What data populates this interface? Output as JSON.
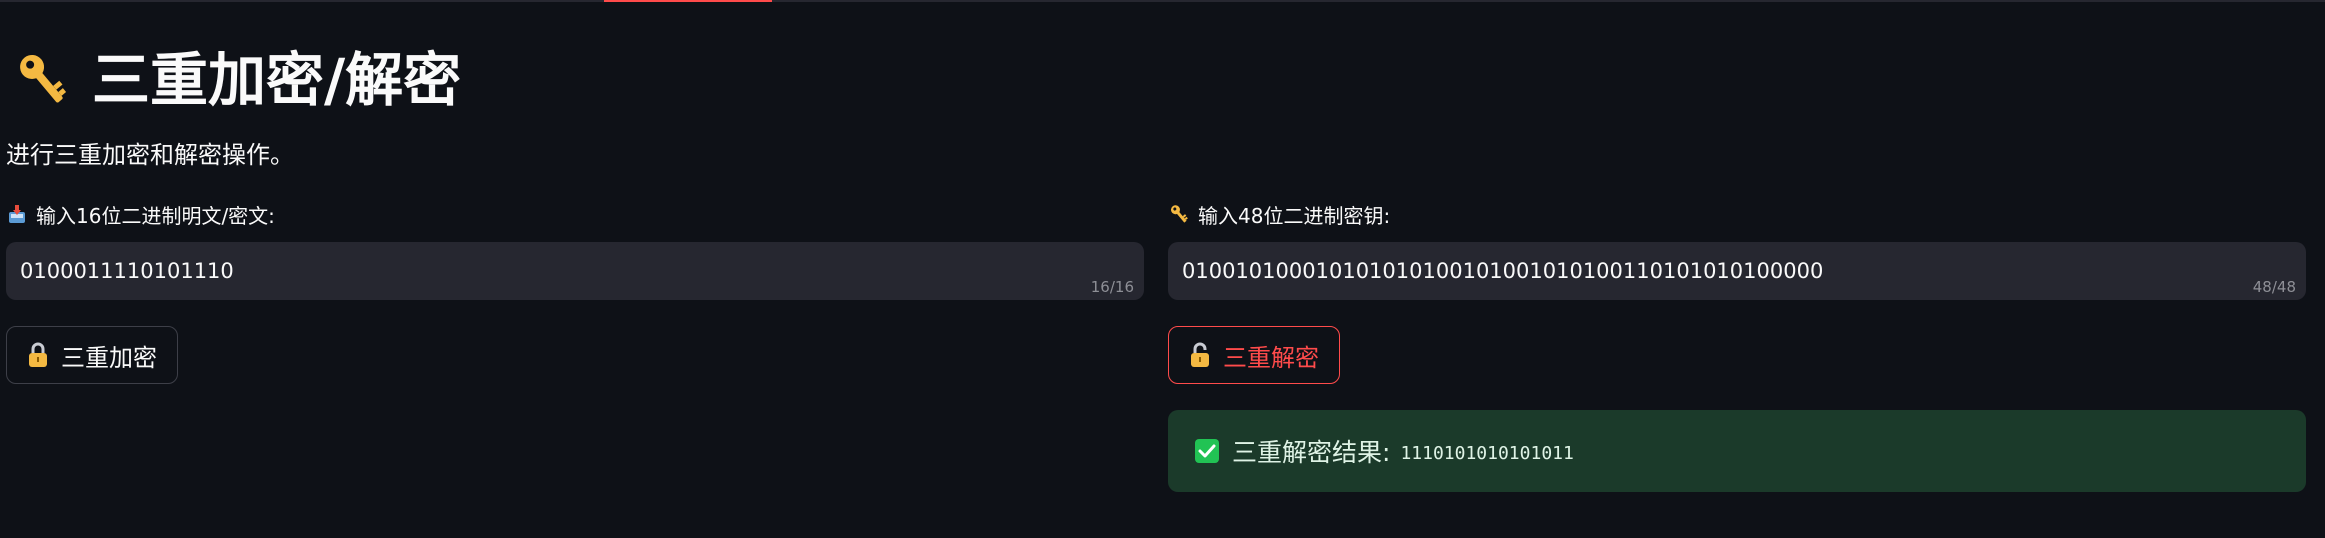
{
  "page": {
    "title": "三重加密/解密",
    "subtitle": "进行三重加密和解密操作。",
    "title_icon": "key-icon"
  },
  "plaintext_field": {
    "icon": "inbox-tray-icon",
    "label": "输入16位二进制明文/密文:",
    "value": "0100011110101110",
    "counter": "16/16"
  },
  "key_field": {
    "icon": "key-icon",
    "label": "输入48位二进制密钥:",
    "value": "010010100010101010100101001010100110101010100000",
    "counter": "48/48"
  },
  "buttons": {
    "encrypt": {
      "icon": "lock-icon",
      "label": "三重加密"
    },
    "decrypt": {
      "icon": "unlock-icon",
      "label": "三重解密"
    }
  },
  "result": {
    "icon": "check-icon",
    "label": "三重解密结果:",
    "value": "1110101010101011"
  },
  "colors": {
    "background": "#0e1117",
    "input_background": "#262730",
    "accent_red": "#ff4b4b",
    "success_background": "#1b3a2a",
    "success_check": "#21c354",
    "key_gold": "#f4b942"
  }
}
